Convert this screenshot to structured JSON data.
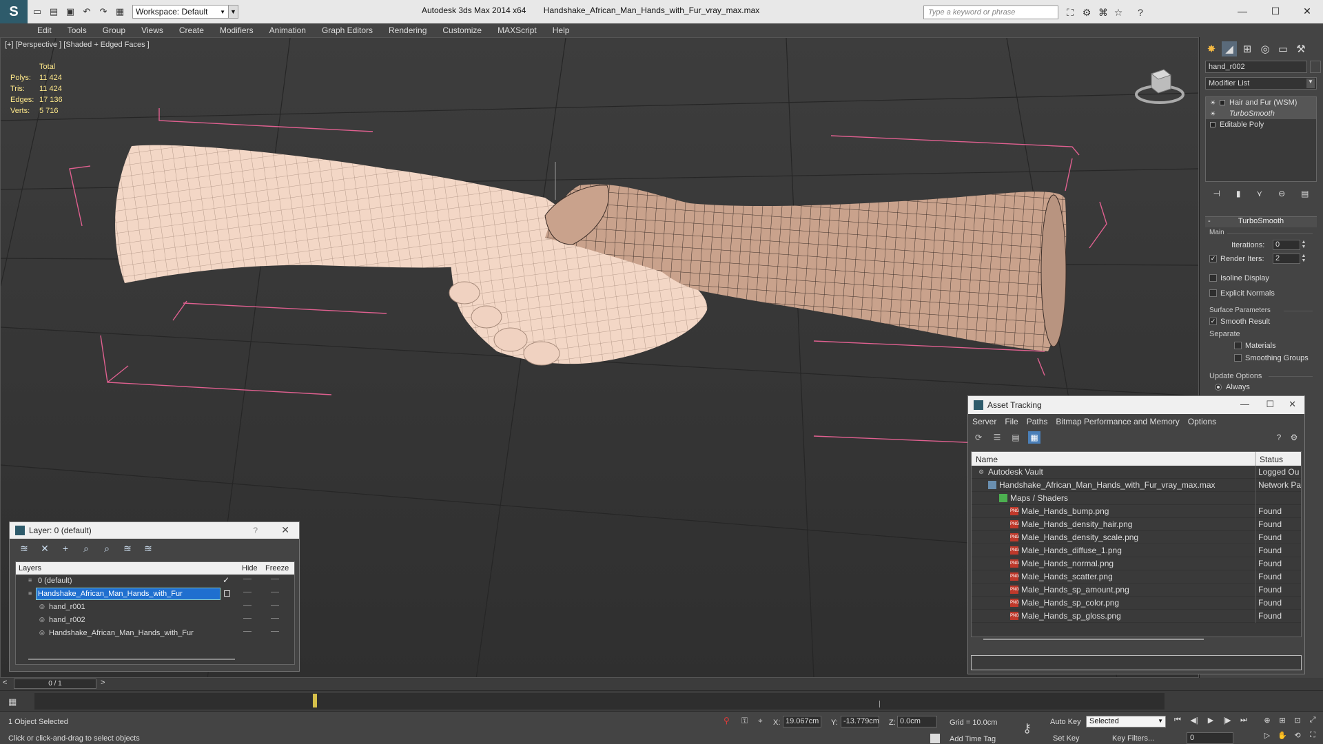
{
  "titlebar": {
    "app_logo": "S",
    "workspace": "Workspace: Default",
    "app_version": "Autodesk 3ds Max  2014 x64",
    "file_name": "Handshake_African_Man_Hands_with_Fur_vray_max.max",
    "search_placeholder": "Type a keyword or phrase"
  },
  "menu": [
    "Edit",
    "Tools",
    "Group",
    "Views",
    "Create",
    "Modifiers",
    "Animation",
    "Graph Editors",
    "Rendering",
    "Customize",
    "MAXScript",
    "Help"
  ],
  "viewport": {
    "label": "[+] [Perspective ] [Shaded + Edged Faces ]",
    "stats_header": "Total",
    "stats": [
      {
        "label": "Polys:",
        "value": "11 424"
      },
      {
        "label": "Tris:",
        "value": "11 424"
      },
      {
        "label": "Edges:",
        "value": "17 136"
      },
      {
        "label": "Verts:",
        "value": "5 716"
      }
    ]
  },
  "command_panel": {
    "object_name": "hand_r002",
    "modifier_list": "Modifier List",
    "stack": [
      {
        "label": "Hair and Fur (WSM)"
      },
      {
        "label": "TurboSmooth"
      },
      {
        "label": "Editable Poly"
      }
    ],
    "rollout_title": "TurboSmooth",
    "main_group": "Main",
    "iterations_label": "Iterations:",
    "iterations_value": "0",
    "render_iters_label": "Render Iters:",
    "render_iters_value": "2",
    "render_iters_checked": true,
    "isoline_label": "Isoline Display",
    "explicit_normals_label": "Explicit Normals",
    "surface_params_group": "Surface Parameters",
    "smooth_result_label": "Smooth Result",
    "smooth_result_checked": true,
    "separate_label": "Separate",
    "materials_label": "Materials",
    "smoothing_groups_label": "Smoothing Groups",
    "update_options_group": "Update Options",
    "always_label": "Always"
  },
  "layer_dialog": {
    "title": "Layer: 0 (default)",
    "help": "?",
    "col_layers": "Layers",
    "col_hide": "Hide",
    "col_freeze": "Freeze",
    "rows": [
      {
        "name": "0 (default)",
        "indent": 1,
        "active": true
      },
      {
        "name": "Handshake_African_Man_Hands_with_Fur",
        "indent": 1,
        "selected": true
      },
      {
        "name": "hand_r001",
        "indent": 2
      },
      {
        "name": "hand_r002",
        "indent": 2
      },
      {
        "name": "Handshake_African_Man_Hands_with_Fur",
        "indent": 2
      }
    ]
  },
  "asset_dialog": {
    "title": "Asset Tracking",
    "menu": [
      "Server",
      "File",
      "Paths",
      "Bitmap Performance and Memory",
      "Options"
    ],
    "col_name": "Name",
    "col_status": "Status",
    "rows": [
      {
        "name": "Autodesk Vault",
        "status": "Logged Ou",
        "kind": "vault",
        "indent": 1
      },
      {
        "name": "Handshake_African_Man_Hands_with_Fur_vray_max.max",
        "status": "Network Pa",
        "kind": "scene",
        "indent": 2
      },
      {
        "name": "Maps / Shaders",
        "status": "",
        "kind": "maps",
        "indent": 3
      },
      {
        "name": "Male_Hands_bump.png",
        "status": "Found",
        "kind": "png",
        "indent": 4
      },
      {
        "name": "Male_Hands_density_hair.png",
        "status": "Found",
        "kind": "png",
        "indent": 4
      },
      {
        "name": "Male_Hands_density_scale.png",
        "status": "Found",
        "kind": "png",
        "indent": 4
      },
      {
        "name": "Male_Hands_diffuse_1.png",
        "status": "Found",
        "kind": "png",
        "indent": 4
      },
      {
        "name": "Male_Hands_normal.png",
        "status": "Found",
        "kind": "png",
        "indent": 4
      },
      {
        "name": "Male_Hands_scatter.png",
        "status": "Found",
        "kind": "png",
        "indent": 4
      },
      {
        "name": "Male_Hands_sp_amount.png",
        "status": "Found",
        "kind": "png",
        "indent": 4
      },
      {
        "name": "Male_Hands_sp_color.png",
        "status": "Found",
        "kind": "png",
        "indent": 4
      },
      {
        "name": "Male_Hands_sp_gloss.png",
        "status": "Found",
        "kind": "png",
        "indent": 4
      }
    ]
  },
  "timeline": {
    "frame_display": "0 / 1"
  },
  "status": {
    "selection": "1 Object Selected",
    "prompt": "Click or click-and-drag to select objects",
    "x_label": "X:",
    "x_value": "19.067cm",
    "y_label": "Y:",
    "y_value": "-13.779cm",
    "z_label": "Z:",
    "z_value": "0.0cm",
    "grid": "Grid = 10.0cm",
    "add_time_tag": "Add Time Tag",
    "auto_key": "Auto Key",
    "set_key": "Set Key",
    "key_filters": "Key Filters...",
    "selected_set": "Selected",
    "current_frame": "0"
  },
  "colors": {
    "accent": "#1f6fcf",
    "viewport_bg": "#3a3a3a",
    "bbox": "#e06090",
    "stats": "#ffe98a",
    "skin_light": "#f3d7c6",
    "skin_dark": "#c9a28c"
  }
}
